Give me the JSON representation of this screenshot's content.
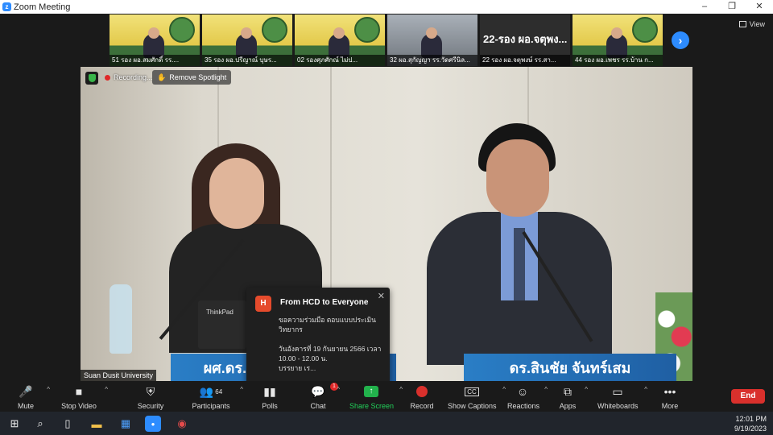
{
  "window": {
    "title": "Zoom Meeting",
    "controls": [
      "–",
      "❐",
      "✕"
    ]
  },
  "gallery": {
    "tiles": [
      {
        "name": "51 รอง ผอ.สมศักดิ์ รร...."
      },
      {
        "name": "35 รอง ผอ.ปรีญาณ์ บุษร..."
      },
      {
        "name": "02 รองศุภศักณ์ ไม่ป..."
      },
      {
        "name": "32 ผอ.สุกัญญา รร.วัดศรีนิล..."
      },
      {
        "name": "22 รอง ผอ.จตุพงษ์ รร.สา..."
      },
      {
        "name": "44 รอง ผอ.เพชร รร.บ้าน ก..."
      }
    ],
    "dark_tile_text": "22-รอง ผอ.จตุพง...",
    "next_button": "›",
    "view_label": "View"
  },
  "main_video": {
    "recording_label": "Recording...",
    "remove_spotlight_label": "Remove Spotlight",
    "participant_label": "Suan Dusit University",
    "laptop_brand": "ThinkPad",
    "left_nameplate": "ผศ.ดร.จิราภรณ์ พงษ์เสมา",
    "right_nameplate": "ดร.สินชัย จันทร์เสม"
  },
  "chat_popup": {
    "avatar_letter": "H",
    "from": "From HCD to Everyone",
    "message": "ขอความร่วมมือ ตอบแบบประเมินวิทยากร\n\nวันอังคารที่ 19 กันยายน 2566 เวลา 10.00 - 12.00 น.\nบรรยาย เร..."
  },
  "toolbar": {
    "mute": "Mute",
    "stop_video": "Stop Video",
    "security": "Security",
    "participants": "Participants",
    "participants_count": "64",
    "polls": "Polls",
    "chat": "Chat",
    "chat_badge": "1",
    "share_screen": "Share Screen",
    "record": "Record",
    "show_captions": "Show Captions",
    "captions_icon_text": "CC",
    "reactions": "Reactions",
    "apps": "Apps",
    "whiteboards": "Whiteboards",
    "more": "More",
    "end": "End"
  },
  "taskbar": {
    "time": "12:01 PM",
    "date": "9/19/2023"
  }
}
